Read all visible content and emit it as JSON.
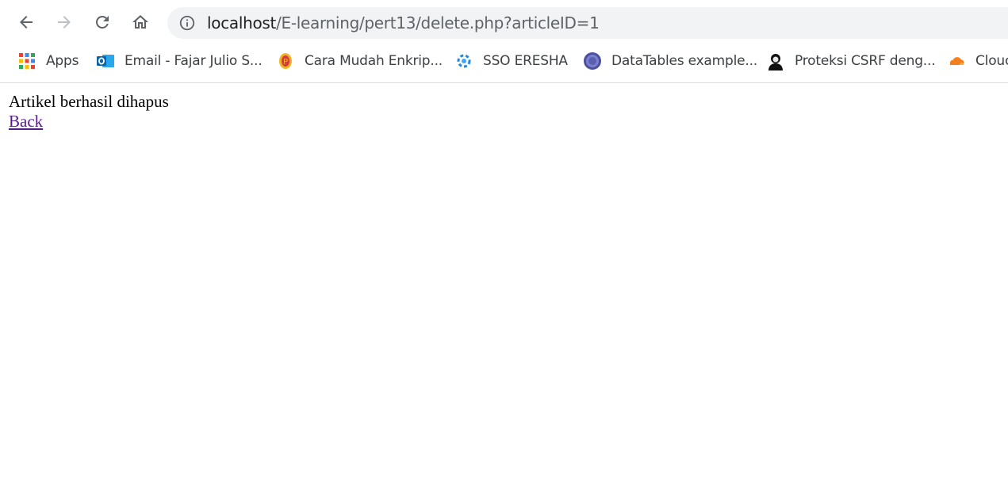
{
  "browser": {
    "url_host": "localhost",
    "url_path": "/E-learning/pert13/delete.php?articleID=1"
  },
  "bookmarks": [
    {
      "label": "Apps",
      "icon": "apps-grid-icon"
    },
    {
      "label": "Email - Fajar Julio S...",
      "icon": "outlook-icon"
    },
    {
      "label": "Cara Mudah Enkrip...",
      "icon": "site-favicon-icon"
    },
    {
      "label": "SSO ERESHA",
      "icon": "sso-logo-icon"
    },
    {
      "label": "DataTables example...",
      "icon": "datatables-logo-icon"
    },
    {
      "label": "Proteksi CSRF deng...",
      "icon": "avatar-favicon-icon"
    },
    {
      "label": "Clouc",
      "icon": "cloudflare-icon"
    }
  ],
  "page": {
    "message": "Artikel berhasil dihapus",
    "back_link": "Back"
  },
  "colors": {
    "link_visited": "#551a8b",
    "omnibox_bg": "#f1f3f4"
  }
}
